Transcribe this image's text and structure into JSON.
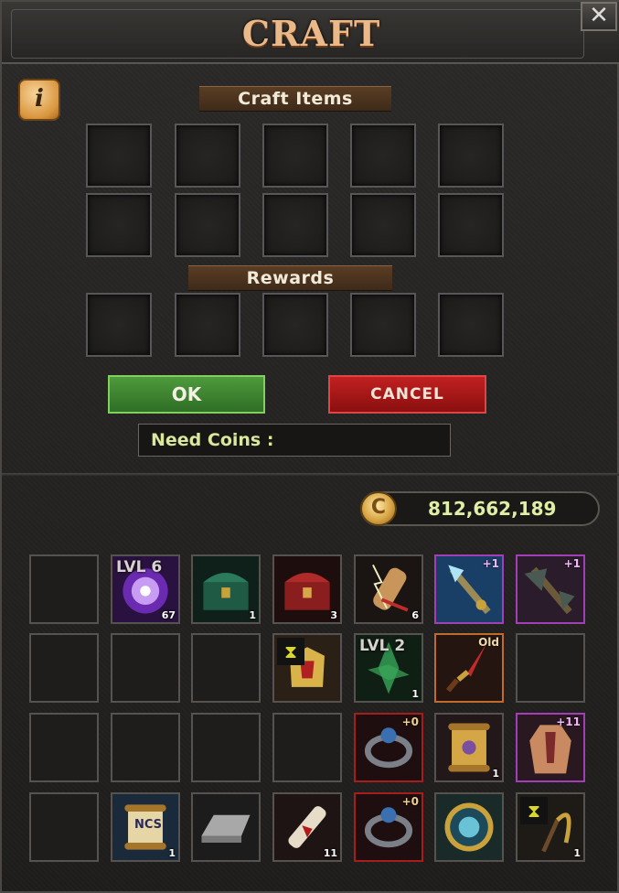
{
  "window": {
    "title": "CRAFT",
    "close_icon": "close-icon"
  },
  "info": {
    "icon_text": "i"
  },
  "craft_items_label": "Craft Items",
  "rewards_label": "Rewards",
  "buttons": {
    "ok": "OK",
    "cancel": "CANCEL"
  },
  "need_coins_label": "Need Coins :",
  "coins": {
    "amount": "812,662,189",
    "icon_text": "C"
  },
  "inventory": [
    [
      {
        "type": "empty"
      },
      {
        "type": "orb",
        "lvl": "LVL 6",
        "count": "67"
      },
      {
        "type": "green-chest",
        "count": "1"
      },
      {
        "type": "red-chest",
        "count": "3"
      },
      {
        "type": "lightning-scroll",
        "count": "6"
      },
      {
        "type": "ice-staff",
        "plus": "+1"
      },
      {
        "type": "dark-axe",
        "plus": "+1"
      }
    ],
    [
      {
        "type": "empty"
      },
      {
        "type": "empty"
      },
      {
        "type": "empty"
      },
      {
        "type": "gold-armor",
        "timed": true
      },
      {
        "type": "green-shard",
        "lvl": "LVL 2",
        "count": "1"
      },
      {
        "type": "dagger",
        "old": "Old"
      },
      {
        "type": "empty"
      }
    ],
    [
      {
        "type": "empty"
      },
      {
        "type": "empty"
      },
      {
        "type": "empty"
      },
      {
        "type": "empty"
      },
      {
        "type": "ring",
        "plus": "+0"
      },
      {
        "type": "gold-scroll",
        "count": "1"
      },
      {
        "type": "robe",
        "plus": "+11"
      }
    ],
    [
      {
        "type": "empty"
      },
      {
        "type": "ncs-scroll",
        "label": "NCS",
        "count": "1"
      },
      {
        "type": "silver-bar"
      },
      {
        "type": "red-scroll",
        "count": "11"
      },
      {
        "type": "ring",
        "plus": "+0"
      },
      {
        "type": "portal"
      },
      {
        "type": "sickle",
        "timed": true,
        "count": "1"
      }
    ]
  ],
  "colors": {
    "ok": "#3e8a31",
    "cancel": "#a81515",
    "title": "#e9b98a",
    "coins_text": "#dff0a6"
  }
}
